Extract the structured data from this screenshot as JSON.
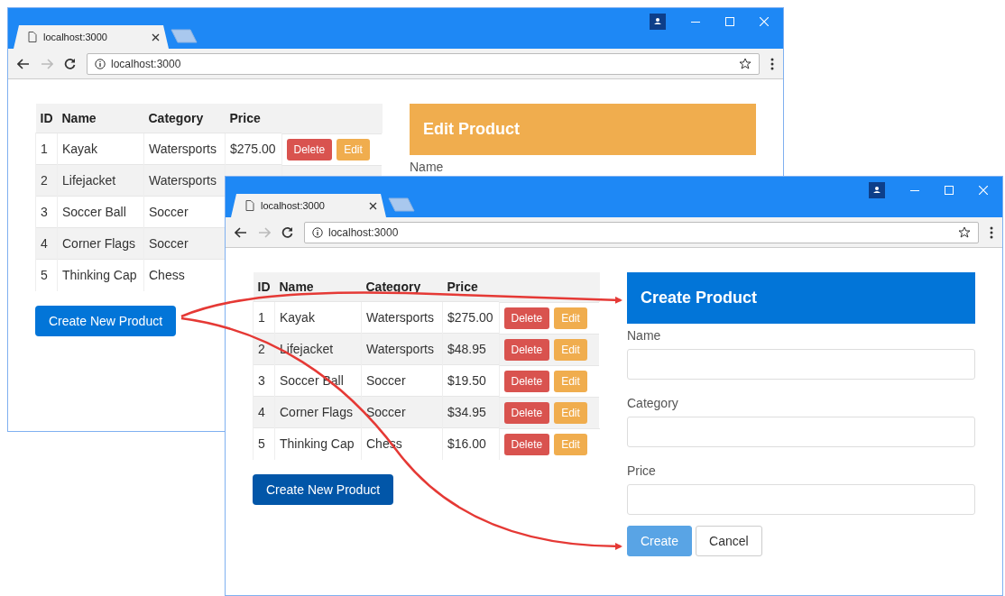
{
  "windows": [
    {
      "tab_title": "localhost:3000",
      "address": "localhost:3000",
      "table": {
        "columns": [
          "ID",
          "Name",
          "Category",
          "Price"
        ],
        "rows": [
          {
            "cells": [
              "1",
              "Kayak",
              "Watersports",
              "$275.00"
            ],
            "actions": [
              "Delete",
              "Edit"
            ]
          },
          {
            "cells": [
              "2",
              "Lifejacket",
              "Watersports"
            ],
            "actions": []
          },
          {
            "cells": [
              "3",
              "Soccer Ball",
              "Soccer"
            ],
            "actions": []
          },
          {
            "cells": [
              "4",
              "Corner Flags",
              "Soccer"
            ],
            "actions": []
          },
          {
            "cells": [
              "5",
              "Thinking Cap",
              "Chess"
            ],
            "actions": []
          }
        ]
      },
      "primary_button": {
        "label": "Create New Product",
        "active": false
      },
      "panel": {
        "kind": "edit",
        "title": "Edit Product",
        "fields": [
          {
            "label": "Name"
          }
        ]
      }
    },
    {
      "tab_title": "localhost:3000",
      "address": "localhost:3000",
      "table": {
        "columns": [
          "ID",
          "Name",
          "Category",
          "Price"
        ],
        "rows": [
          {
            "cells": [
              "1",
              "Kayak",
              "Watersports",
              "$275.00"
            ],
            "actions": [
              "Delete",
              "Edit"
            ]
          },
          {
            "cells": [
              "2",
              "Lifejacket",
              "Watersports",
              "$48.95"
            ],
            "actions": [
              "Delete",
              "Edit"
            ]
          },
          {
            "cells": [
              "3",
              "Soccer Ball",
              "Soccer",
              "$19.50"
            ],
            "actions": [
              "Delete",
              "Edit"
            ]
          },
          {
            "cells": [
              "4",
              "Corner Flags",
              "Soccer",
              "$34.95"
            ],
            "actions": [
              "Delete",
              "Edit"
            ]
          },
          {
            "cells": [
              "5",
              "Thinking Cap",
              "Chess",
              "$16.00"
            ],
            "actions": [
              "Delete",
              "Edit"
            ]
          }
        ]
      },
      "primary_button": {
        "label": "Create New Product",
        "active": true
      },
      "panel": {
        "kind": "create",
        "title": "Create Product",
        "fields": [
          {
            "label": "Name"
          },
          {
            "label": "Category"
          },
          {
            "label": "Price"
          }
        ],
        "buttons": [
          {
            "label": "Create",
            "kind": "primary",
            "disabled": true
          },
          {
            "label": "Cancel",
            "kind": "secondary",
            "disabled": false
          }
        ]
      }
    }
  ]
}
